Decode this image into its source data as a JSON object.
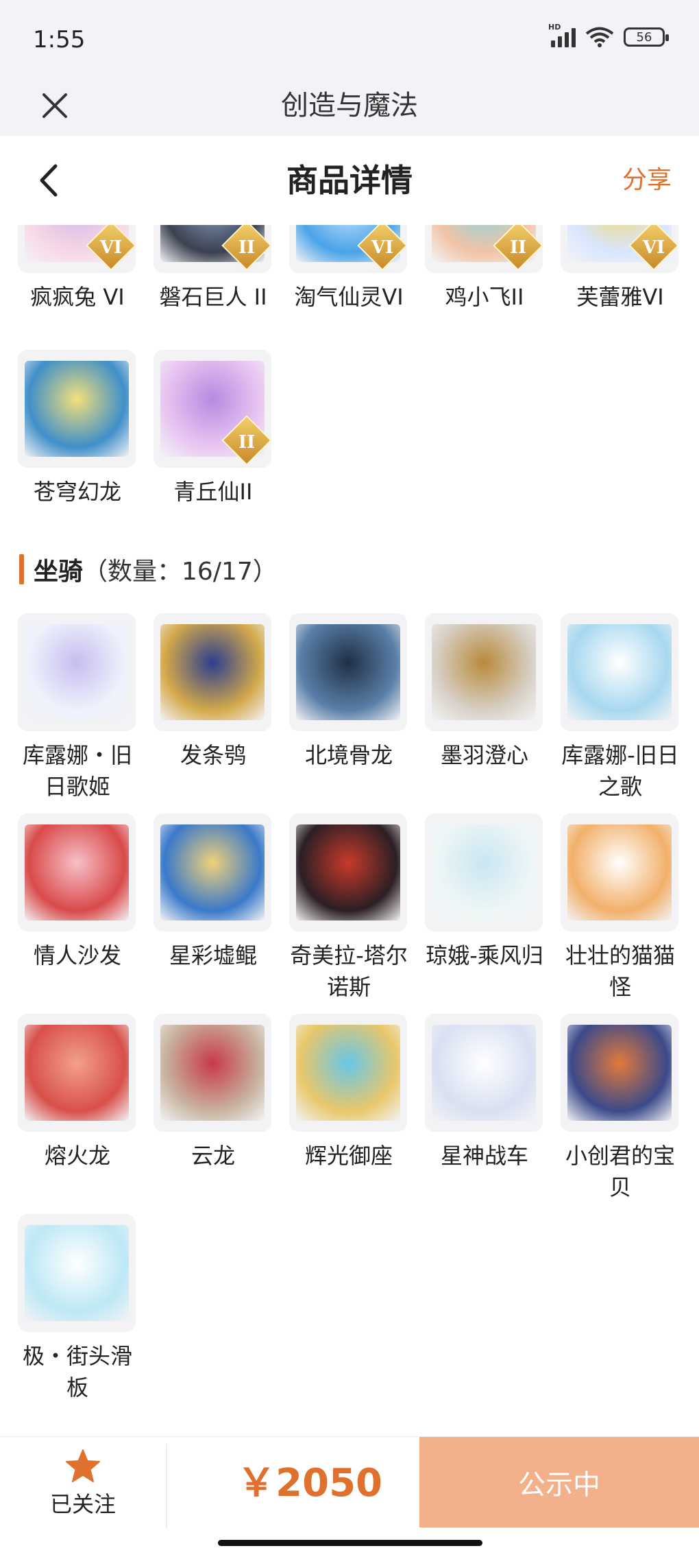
{
  "status_bar": {
    "time": "1:55",
    "battery": "56",
    "network_label": "HD"
  },
  "app_header": {
    "title": "创造与魔法"
  },
  "page_header": {
    "title": "商品详情",
    "share": "分享"
  },
  "pets_partial": [
    {
      "name": "疯疯兔 VI",
      "badge": "VI",
      "icon": "pink-rabbit-pet"
    },
    {
      "name": "磐石巨人 II",
      "badge": "II",
      "icon": "stone-giant-pet"
    },
    {
      "name": "淘气仙灵VI",
      "badge": "VI",
      "icon": "blue-spirit-pet"
    },
    {
      "name": "鸡小飞II",
      "badge": "II",
      "icon": "chicken-pet"
    },
    {
      "name": "芙蕾雅VI",
      "badge": "VI",
      "icon": "freya-pet"
    },
    {
      "name": "苍穹幻龙",
      "badge": "",
      "icon": "sky-dragon-pet"
    },
    {
      "name": "青丘仙II",
      "badge": "II",
      "icon": "fox-fairy-pet"
    }
  ],
  "mounts_section": {
    "name": "坐骑",
    "count_text": "（数量：16/17）"
  },
  "mounts": [
    {
      "name": "库露娜・旧日歌姬",
      "icon": "kuluna-singer-mount"
    },
    {
      "name": "发条鸮",
      "icon": "clockwork-owl-mount"
    },
    {
      "name": "北境骨龙",
      "icon": "bone-dragon-mount"
    },
    {
      "name": "墨羽澄心",
      "icon": "ink-feather-mount"
    },
    {
      "name": "库露娜-旧日之歌",
      "icon": "kuluna-song-mount"
    },
    {
      "name": "情人沙发",
      "icon": "lover-sofa-mount"
    },
    {
      "name": "星彩墟鲲",
      "icon": "star-whale-mount"
    },
    {
      "name": "奇美拉-塔尔诺斯",
      "icon": "chimera-mount"
    },
    {
      "name": "琼娥-乘风归",
      "icon": "qiong-e-mount"
    },
    {
      "name": "壮壮的猫猫怪",
      "icon": "cat-monster-mount"
    },
    {
      "name": "熔火龙",
      "icon": "lava-dragon-mount"
    },
    {
      "name": "云龙",
      "icon": "cloud-dragon-mount"
    },
    {
      "name": "辉光御座",
      "icon": "radiant-throne-mount"
    },
    {
      "name": "星神战车",
      "icon": "star-chariot-mount"
    },
    {
      "name": "小创君的宝贝",
      "icon": "phoenix-bird-mount"
    },
    {
      "name": "极・街头滑板",
      "icon": "street-skateboard-mount"
    }
  ],
  "bottom_bar": {
    "follow_label": "已关注",
    "price": "￥2050",
    "status_button": "公示中"
  },
  "colors": {
    "accent": "#e0702e",
    "button": "#f3b08a",
    "badge_gold": "#d9a441"
  }
}
